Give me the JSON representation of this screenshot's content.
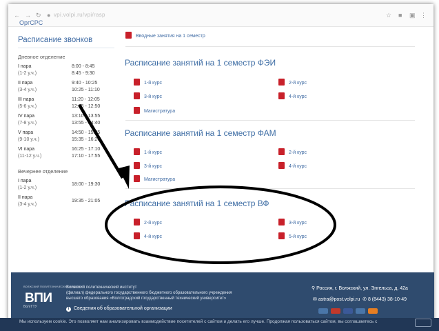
{
  "browser": {
    "url": "vpi.volpi.ru/vpi/rasp",
    "icons": [
      "lock-icon",
      "star-icon",
      "extensions-icon",
      "menu-icon"
    ]
  },
  "breadcrumb_tail": "ОргСРС",
  "sidebar": {
    "title": "Расписание звонков",
    "day_label": "Дневное отделение",
    "evening_label": "Вечернее отделение",
    "day_rows": [
      {
        "pair": "I пара",
        "sub": "(1-2 у.ч.)",
        "t1": "8:00 - 8:45",
        "t2": "8:45 - 9:30"
      },
      {
        "pair": "II пара",
        "sub": "(3-4 у.ч.)",
        "t1": "9:40 - 10:25",
        "t2": "10:25 - 11:10"
      },
      {
        "pair": "III пара",
        "sub": "(5-6 у.ч.)",
        "t1": "11:20 - 12:05",
        "t2": "12:05 - 12:50"
      },
      {
        "pair": "IV пара",
        "sub": "(7-8 у.ч.)",
        "t1": "13:10 - 13:55",
        "t2": "13:55 - 14:40"
      },
      {
        "pair": "V пара",
        "sub": "(9-10 у.ч.)",
        "t1": "14:50 - 15:35",
        "t2": "15:35 - 16:20"
      },
      {
        "pair": "VI пара",
        "sub": "(11-12 у.ч.)",
        "t1": "16:25 - 17:10",
        "t2": "17:10 - 17:55"
      }
    ],
    "evening_rows": [
      {
        "pair": "I пара",
        "sub": "(1-2 у.ч.)",
        "t1": "18:00 - 19:30"
      },
      {
        "pair": "II пара",
        "sub": "(3-4 у.ч.)",
        "t1": "19:35 - 21:05"
      }
    ]
  },
  "main": {
    "intro_link": "Вводные занятия на 1 семестр",
    "sections": [
      {
        "title": "Расписание занятий на 1 семестр ФЭИ",
        "links": [
          "1-й курс",
          "2-й курс",
          "3-й курс",
          "4-й курс",
          "Магистратура"
        ]
      },
      {
        "title": "Расписание занятий на 1 семестр ФАМ",
        "links": [
          "1-й курс",
          "2-й курс",
          "3-й курс",
          "4-й курс",
          "Магистратура"
        ]
      },
      {
        "title": "Расписание занятий на 1 семестр ВФ",
        "links": [
          "2-й курс",
          "3-й курс",
          "4-й курс",
          "5-й курс"
        ]
      }
    ]
  },
  "footer": {
    "logo_pre": "ВОЛЖСКИЙ ПОЛИТЕХНИЧЕСКИЙ ИНСТИТУТ",
    "logo": "ВПИ",
    "logo_post": "ВолгГТУ",
    "org_lines": [
      "Волжский политехнический институт",
      "(филиал) федерального государственного бюджетного образовательного учреждения",
      "высшего образования «Волгоградский государственный технический университет»"
    ],
    "info_link": "Сведения об образовательной организации",
    "address": "Россия, г. Волжский, ул. Энгельса, д. 42а",
    "email": "astra@post.volpi.ru",
    "phone": "8 (8443) 38-10-49",
    "social_colors": [
      "#4a76a8",
      "#c0392b",
      "#3b5998",
      "#e67e22",
      "#888888"
    ]
  },
  "cookie": {
    "text": "Мы используем cookie. Это позволяет нам анализировать взаимодействие посетителей с сайтом и делать его лучше. Продолжая пользоваться сайтом, вы соглашаетесь с"
  },
  "annotation": {
    "color": "#000000"
  },
  "colors": {
    "accent": "#3f6ea5",
    "pdf": "#c8202a",
    "footer": "#2f4b6e"
  }
}
